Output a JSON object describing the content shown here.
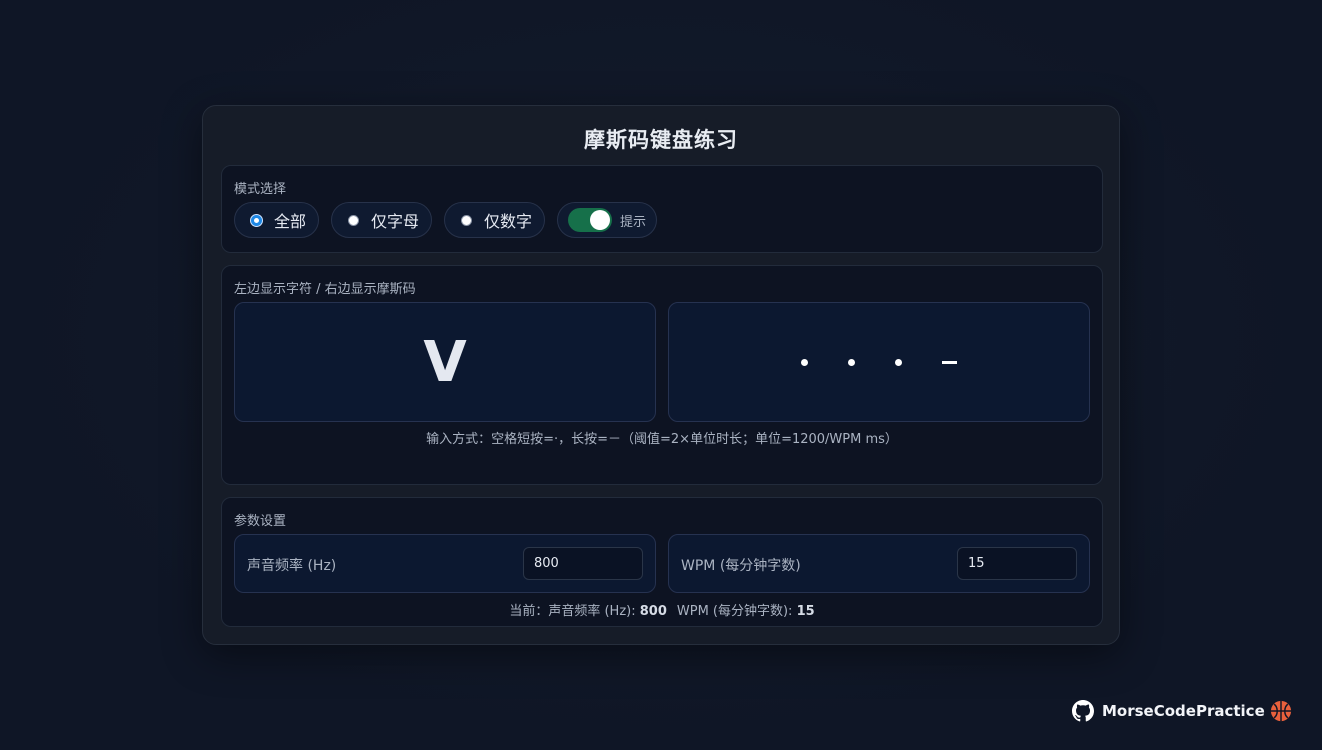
{
  "app": {
    "title": "摩斯码键盘练习"
  },
  "mode": {
    "label": "模式选择",
    "options": [
      {
        "label": "全部",
        "selected": true
      },
      {
        "label": "仅字母",
        "selected": false
      },
      {
        "label": "仅数字",
        "selected": false
      }
    ],
    "hint_toggle": {
      "label": "提示",
      "on": true
    }
  },
  "display": {
    "label": "左边显示字符 / 右边显示摩斯码",
    "character": "V",
    "morse": "...-",
    "input_hint": "输入方式：空格短按=·，长按=－（阈值=2×单位时长；单位=1200/WPM ms）"
  },
  "params": {
    "label": "参数设置",
    "frequency": {
      "label": "声音频率 (Hz)",
      "value": "800"
    },
    "wpm": {
      "label": "WPM (每分钟字数)",
      "value": "15"
    },
    "current": {
      "prefix": "当前：",
      "freq_label": "声音频率 (Hz): ",
      "freq_value": "800",
      "wpm_label": "WPM (每分钟字数): ",
      "wpm_value": "15"
    }
  },
  "footer": {
    "repo_name": "MorseCodePractice"
  },
  "colors": {
    "accent": "#1e88e5",
    "toggle_on": "#16704a",
    "background": "#0f1626"
  }
}
